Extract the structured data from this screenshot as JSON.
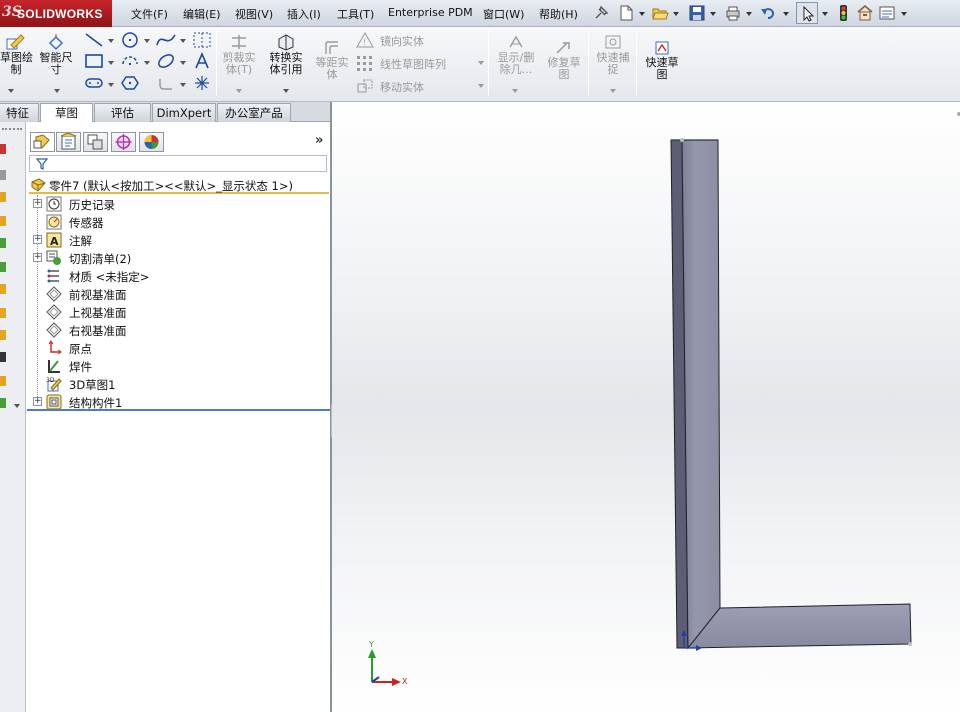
{
  "app": {
    "logo_ds": "3S",
    "logo_word": "SOLIDWORKS"
  },
  "menu": [
    "文件(F)",
    "编辑(E)",
    "视图(V)",
    "插入(I)",
    "工具(T)",
    "Enterprise PDM",
    "窗口(W)",
    "帮助(H)"
  ],
  "toolbar_icons": [
    "pin-icon",
    "new-document-icon",
    "open-folder-icon",
    "save-icon",
    "print-icon",
    "undo-icon",
    "select-arrow-icon",
    "rebuild-traffic-light-icon",
    "file-properties-icon",
    "options-icon"
  ],
  "commands": {
    "sketch": "草图绘\n制",
    "smart_dimension": "智能尺\n寸",
    "trim": "剪裁实\n体(T)",
    "convert": "转换实\n体引用",
    "offset": "等距实\n体",
    "mirror": "镜向实体",
    "linear_pattern": "线性草图阵列",
    "move": "移动实体",
    "show_delete": "显示/删\n除几...",
    "repair": "修复草\n图",
    "quick_snaps": "快速捕\n捉",
    "rapid_sketch": "快速草\n图"
  },
  "tabs": [
    "特征",
    "草图",
    "评估",
    "DimXpert",
    "办公室产品"
  ],
  "active_tab": "草图",
  "feature_tree": {
    "root": "零件7  (默认<按加工><<默认>_显示状态 1>)",
    "items": [
      {
        "label": "历史记录",
        "icon": "history-icon",
        "expandable": true
      },
      {
        "label": "传感器",
        "icon": "sensor-icon",
        "expandable": false
      },
      {
        "label": "注解",
        "icon": "annotation-icon",
        "expandable": true
      },
      {
        "label": "切割清单(2)",
        "icon": "cut-list-icon",
        "expandable": true
      },
      {
        "label": "材质 <未指定>",
        "icon": "material-icon",
        "expandable": false
      },
      {
        "label": "前视基准面",
        "icon": "plane-icon",
        "expandable": false
      },
      {
        "label": "上视基准面",
        "icon": "plane-icon",
        "expandable": false
      },
      {
        "label": "右视基准面",
        "icon": "plane-icon",
        "expandable": false
      },
      {
        "label": "原点",
        "icon": "origin-icon",
        "expandable": false
      },
      {
        "label": "焊件",
        "icon": "weldment-icon",
        "expandable": false
      },
      {
        "label": "3D草图1",
        "icon": "3d-sketch-icon",
        "expandable": false
      },
      {
        "label": "结构构件1",
        "icon": "structural-member-icon",
        "expandable": true
      }
    ]
  },
  "triad": {
    "y": "Y",
    "x": "X"
  },
  "colors": {
    "logo_red": "#b71c22",
    "model_face": "#8e91a8",
    "model_dark": "#5d6076",
    "rollback_bar": "#4d7cc7",
    "root_underline": "#e8b84a"
  }
}
